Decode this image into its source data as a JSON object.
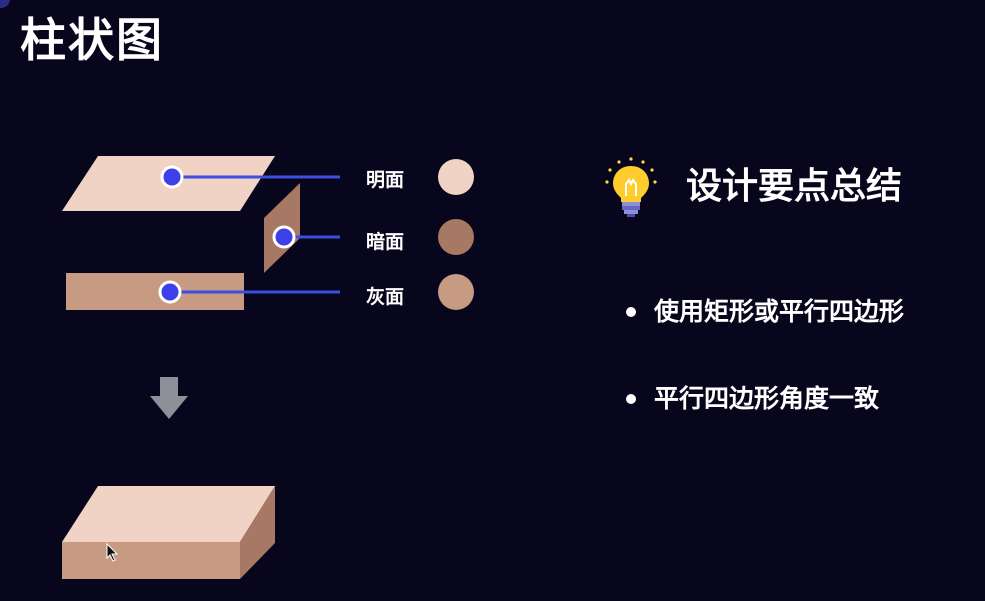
{
  "title": "柱状图",
  "legend": [
    {
      "label": "明面",
      "color": "#f0d3c4"
    },
    {
      "label": "暗面",
      "color": "#a77965"
    },
    {
      "label": "灰面",
      "color": "#c69b82"
    }
  ],
  "summary": {
    "icon": "lightbulb-icon",
    "title": "设计要点总结",
    "points": [
      "使用矩形或平行四边形",
      "平行四边形角度一致"
    ]
  },
  "colors": {
    "background": "#07061c",
    "light_face": "#f0d3c4",
    "dark_face": "#a77965",
    "gray_face": "#c69b82",
    "callout_line": "#3d4ee0",
    "arrow": "#8f8f99"
  }
}
